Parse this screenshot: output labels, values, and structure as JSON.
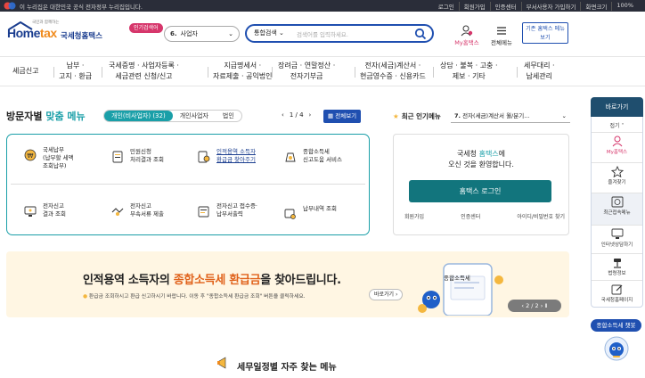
{
  "topbar": {
    "notice": "이 누리집은 대한민국 공식 전자정부 누리집입니다.",
    "links": [
      "로그인",
      "회원가입",
      "인증센터",
      "부서사용자 가입하기",
      "화면크기",
      "100%"
    ]
  },
  "header": {
    "logo_sub": "국민과 함께하는",
    "logo_main_a": "Home",
    "logo_main_b": "tax",
    "logo_kr": "국세청홈택스",
    "popular_badge": "인기검색어",
    "popular_num": "6.",
    "popular_item": "사업자",
    "search_category": "통합검색",
    "search_placeholder": "검색어를 입력하세요.",
    "my_hometax": "My홈택스",
    "all_menu": "전체메뉴",
    "old_hometax": "기존 홈택스 메뉴 보기"
  },
  "nav": [
    {
      "l1": "세금신고",
      "l2": ""
    },
    {
      "l1": "납부 ·",
      "l2": "고지 · 환급"
    },
    {
      "l1": "국세증명 · 사업자등록 ·",
      "l2": "세금관련 신청/신고"
    },
    {
      "l1": "지급명세서 ·",
      "l2": "자료제출 · 공익법인"
    },
    {
      "l1": "장려금 · 연말정산 ·",
      "l2": "전자기부금"
    },
    {
      "l1": "전자(세금)계산서 ·",
      "l2": "현금영수증 · 신용카드"
    },
    {
      "l1": "상담 · 불복 · 고충 ·",
      "l2": "제보 · 기타"
    },
    {
      "l1": "세무대리 ·",
      "l2": "납세관리"
    }
  ],
  "section": {
    "title_a": "방문자별",
    "title_b": "맞춤 메뉴",
    "tabs": [
      "개인(비사업자) (32)",
      "개인사업자",
      "법인"
    ],
    "page": "1 / 4",
    "all_view": "전체보기"
  },
  "menu_items": [
    {
      "l1": "국세납부",
      "l2": "(납부할 세액",
      "l3": "조회납부)"
    },
    {
      "l1": "민원신청",
      "l2": "처리결과 조회",
      "l3": ""
    },
    {
      "l1": "인적용역 소득자",
      "l2": "환급금 찾아주기",
      "l3": ""
    },
    {
      "l1": "종합소득세",
      "l2": "신고도움 서비스",
      "l3": ""
    },
    {
      "l1": "전자신고",
      "l2": "결과 조회",
      "l3": ""
    },
    {
      "l1": "전자신고",
      "l2": "부속서류 제출",
      "l3": ""
    },
    {
      "l1": "전자신고 접수증·",
      "l2": "납부서출력",
      "l3": ""
    },
    {
      "l1": "납부내역 조회",
      "l2": "",
      "l3": ""
    }
  ],
  "popular_menu": {
    "title": "최근 인기메뉴",
    "num": "7.",
    "item": "전자(세금)계산서 월/분기..."
  },
  "login": {
    "welcome_a": "국세청",
    "welcome_b": "홈택스",
    "welcome_c": "에",
    "welcome_line2": "오신 것을 환영합니다.",
    "button": "홈택스 로그인",
    "links": [
      "회원가입",
      "인증센터",
      "아이디/비밀번호 찾기"
    ]
  },
  "banner": {
    "title_a": "인적용역 소득자의",
    "title_b": "종합소득세 환급금",
    "title_c": "을 찾아드립니다.",
    "sub": "환급금 조회하시고 환급 신고하시기 바랍니다. 이동 후 \"종합소득세 환급금 조회\" 버튼을 클릭하세요.",
    "btn": "바로가기",
    "card_label": "종합소득세",
    "pager": "2 / 2"
  },
  "schedule": {
    "title": "세무일정별 자주 찾는 메뉴"
  },
  "quick": {
    "title": "바로가기",
    "fold": "접기",
    "items": [
      "My홈택스",
      "즐겨찾기",
      "최근접속메뉴",
      "인터넷상담하기",
      "법령정보",
      "국세청홈페이지"
    ],
    "chatbot": "종합소득세 챗봇"
  },
  "colors": {
    "brand": "#1a3d8f",
    "accent": "#1a9fa8",
    "login": "#12757d",
    "highlight": "#e0621b"
  }
}
